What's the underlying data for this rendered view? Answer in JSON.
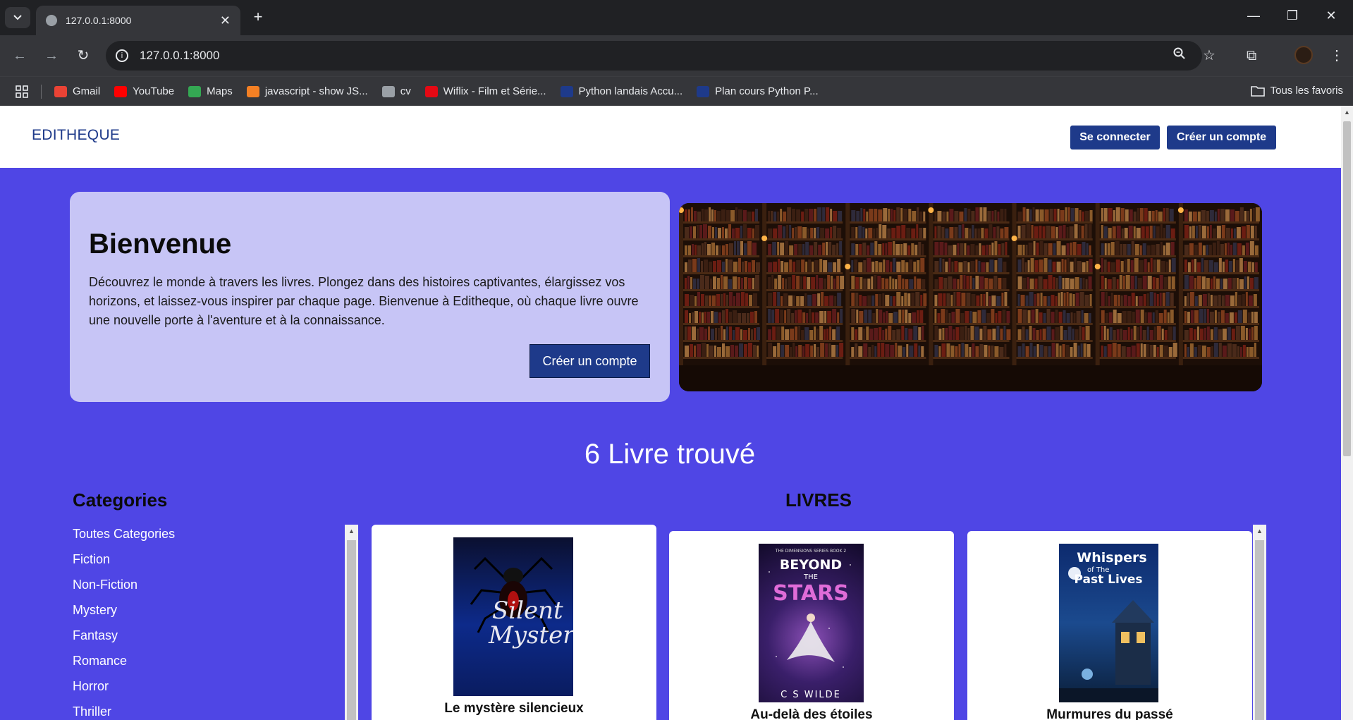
{
  "browser": {
    "tab_title": "127.0.0.1:8000",
    "url": "127.0.0.1:8000",
    "bookmarks": [
      {
        "label": "Gmail",
        "icon": "gmail-icon",
        "color": "#ea4335"
      },
      {
        "label": "YouTube",
        "icon": "youtube-icon",
        "color": "#ff0000"
      },
      {
        "label": "Maps",
        "icon": "maps-icon",
        "color": "#34a853"
      },
      {
        "label": "javascript - show JS...",
        "icon": "stackoverflow-icon",
        "color": "#f48024"
      },
      {
        "label": "cv",
        "icon": "globe-icon",
        "color": "#9aa0a6"
      },
      {
        "label": "Wiflix - Film et Série...",
        "icon": "wiflix-icon",
        "color": "#e50914"
      },
      {
        "label": "Python landais Accu...",
        "icon": "python-icon",
        "color": "#1e3a8a"
      },
      {
        "label": "Plan cours Python P...",
        "icon": "python-icon",
        "color": "#1e3a8a"
      }
    ],
    "all_bookmarks_label": "Tous les favoris"
  },
  "header": {
    "brand": "EDITHEQUE",
    "login_label": "Se connecter",
    "signup_label": "Créer un compte"
  },
  "hero": {
    "title": "Bienvenue",
    "text": "Découvrez le monde à travers les livres. Plongez dans des histoires captivantes, élargissez vos horizons, et laissez-vous inspirer par chaque page. Bienvenue à Editheque, où chaque livre ouvre une nouvelle porte à l'aventure et à la connaissance.",
    "cta_label": "Créer un compte"
  },
  "results": {
    "count_text": "6 Livre trouvé"
  },
  "categories": {
    "title": "Categories",
    "items": [
      "Toutes Categories",
      "Fiction",
      "Non-Fiction",
      "Mystery",
      "Fantasy",
      "Romance",
      "Horror",
      "Thriller"
    ]
  },
  "books": {
    "title": "LIVRES",
    "items": [
      {
        "title": "Le mystère silencieux",
        "cover_text": [
          "Silent",
          "Mystery"
        ]
      },
      {
        "title": "Au-delà des étoiles",
        "cover_text": [
          "THE DIMENSIONS SERIES BOOK 2",
          "BEYOND",
          "THE",
          "STARS",
          "C S WILDE"
        ]
      },
      {
        "title": "Murmures du passé",
        "cover_text": [
          "Whispers",
          "of The",
          "Past Lives"
        ]
      }
    ]
  },
  "colors": {
    "accent": "#4f46e5",
    "primary": "#1e3a8a",
    "hero_card": "#c7c5f6"
  }
}
